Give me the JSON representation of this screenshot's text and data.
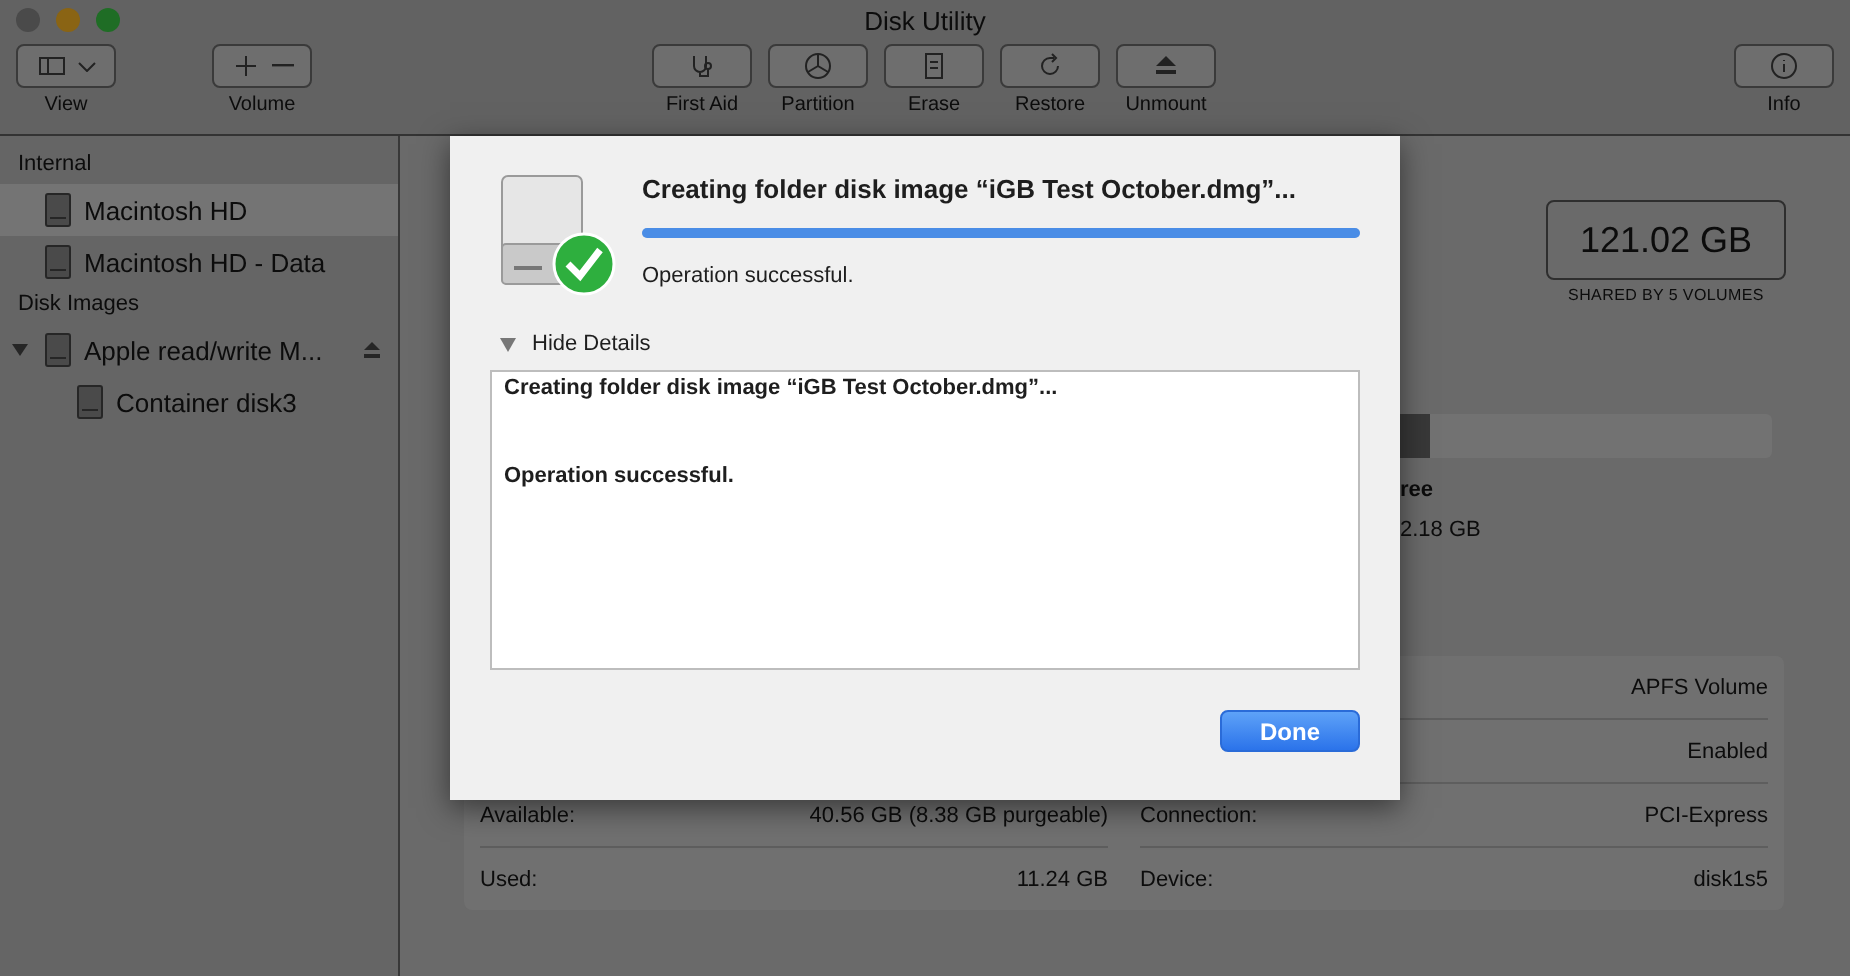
{
  "window": {
    "title": "Disk Utility"
  },
  "toolbar": [
    {
      "label": "View",
      "kind": "view"
    },
    {
      "label": "Volume",
      "kind": "volume"
    },
    {
      "label": "First Aid",
      "kind": "firstaid"
    },
    {
      "label": "Partition",
      "kind": "partition"
    },
    {
      "label": "Erase",
      "kind": "erase"
    },
    {
      "label": "Restore",
      "kind": "restore"
    },
    {
      "label": "Unmount",
      "kind": "unmount"
    },
    {
      "label": "Info",
      "kind": "info"
    }
  ],
  "sidebar": {
    "sections": [
      {
        "title": "Internal",
        "items": [
          {
            "label": "Macintosh HD",
            "selected": true
          },
          {
            "label": "Macintosh HD - Data",
            "selected": false
          }
        ]
      },
      {
        "title": "Disk Images",
        "items": [
          {
            "label": "Apple read/write M...",
            "selected": false,
            "expanded": true,
            "ejectable": true,
            "children": [
              {
                "label": "Container disk3",
                "selected": false
              }
            ]
          }
        ]
      }
    ]
  },
  "capacity": {
    "value": "121.02 GB",
    "caption": "SHARED BY 5 VOLUMES"
  },
  "usage": {
    "label": "ree",
    "value": "2.18 GB"
  },
  "info": {
    "left": [
      {
        "label": "Available:",
        "value": "40.56 GB (8.38 GB purgeable)"
      },
      {
        "label": "Used:",
        "value": "11.24 GB"
      }
    ],
    "right": [
      {
        "value": "APFS Volume"
      },
      {
        "value": "Enabled"
      },
      {
        "label": "Connection:",
        "value": "PCI-Express"
      },
      {
        "label": "Device:",
        "value": "disk1s5"
      }
    ]
  },
  "sheet": {
    "title": "Creating folder disk image “iGB Test October.dmg”...",
    "progress": {
      "level": 1.0
    },
    "status": "Operation successful.",
    "details_toggle": {
      "label": "Hide Details",
      "expanded": true
    },
    "details": [
      "Creating folder disk image “iGB Test October.dmg”...",
      "Operation successful."
    ],
    "button": "Done"
  }
}
